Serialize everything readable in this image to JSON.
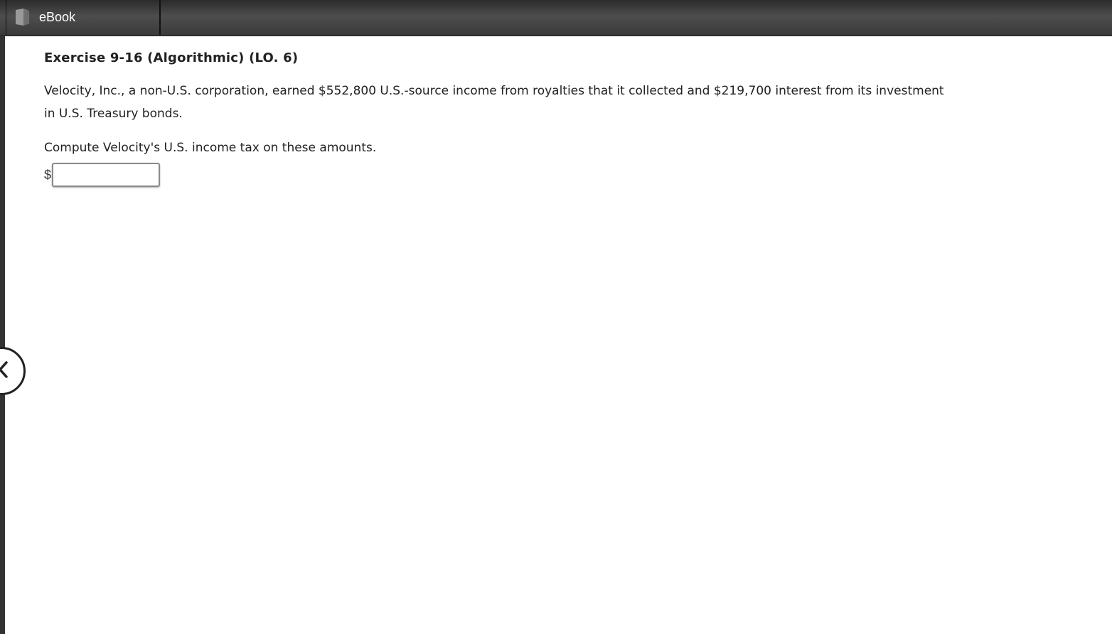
{
  "header": {
    "tab_label": "eBook",
    "tab_icon": "book-icon"
  },
  "exercise": {
    "title": "Exercise 9-16 (Algorithmic) (LO. 6)",
    "paragraph1": "Velocity, Inc., a non-U.S. corporation, earned $552,800 U.S.-source income from royalties that it collected and $219,700 interest from its investment in U.S. Treasury bonds.",
    "paragraph2": "Compute Velocity's U.S. income tax on these amounts.",
    "currency_symbol": "$",
    "answer_value": ""
  },
  "navigation": {
    "previous_icon": "chevron-left-icon"
  },
  "colors": {
    "topbar": "#3a3a3a",
    "text": "#222222"
  }
}
